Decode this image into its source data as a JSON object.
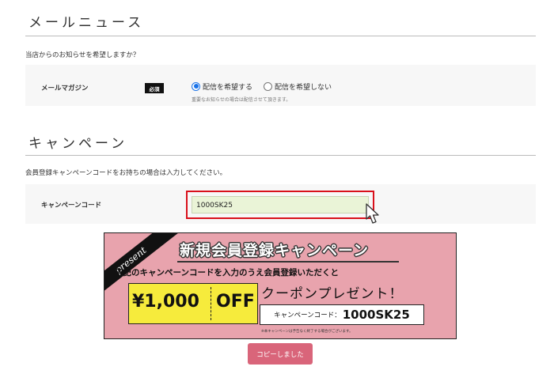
{
  "mail_section": {
    "title": "メールニュース",
    "description": "当店からのお知らせを希望しますか？",
    "row_label": "メールマガジン",
    "required_badge": "必須",
    "options": [
      {
        "label": "配信を希望する",
        "selected": true
      },
      {
        "label": "配信を希望しない",
        "selected": false
      }
    ],
    "note": "重要なお知らせの場合は配信させて頂きます。"
  },
  "campaign_section": {
    "title": "キャンペーン",
    "description": "会員登録キャンペーンコードをお持ちの場合は入力してください。",
    "row_label": "キャンペーンコード",
    "input_value": "1000SK25"
  },
  "banner": {
    "present": "present",
    "title": "新規会員登録キャンペーン",
    "subtitle": "下記のキャンペーンコードを入力のうえ会員登録いただくと",
    "amount": "¥1,000",
    "off": "OFF",
    "coupon_text": "クーポンプレゼント！",
    "code_label": "キャンペーンコード：",
    "code_value": "1000SK25",
    "footnote": "※本キャンペーンは予告なく終了する場合がございます。"
  },
  "copy_button": {
    "label": "コピーしました"
  },
  "colors": {
    "accent_red": "#d9101b",
    "banner_pink": "#e8a3ad",
    "ticket_yellow": "#f6eb3c",
    "button_pink": "#d9657a",
    "radio_blue": "#1a73e8"
  },
  "icons": {
    "cursor": "pointer-hand-icon"
  }
}
